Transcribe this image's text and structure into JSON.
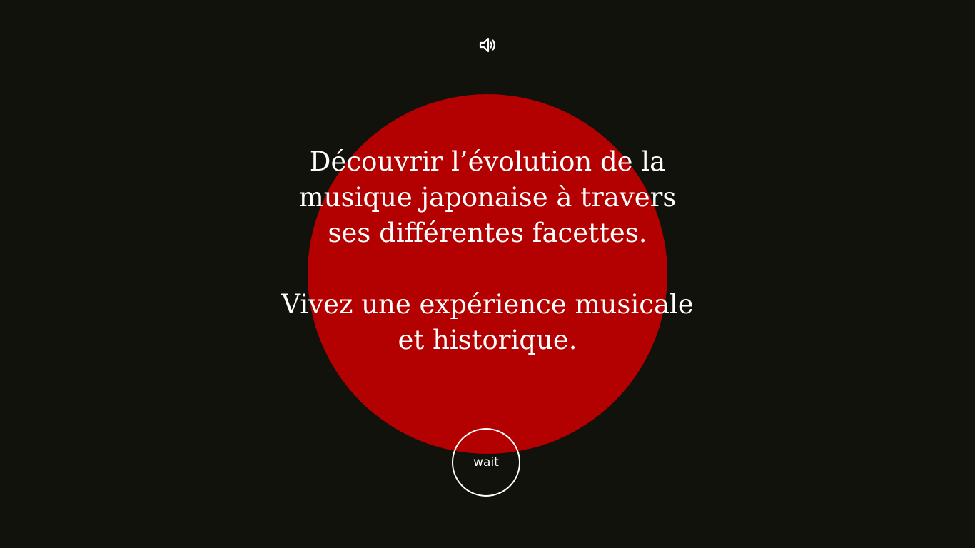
{
  "header": {
    "sound_icon": "speaker-volume-icon"
  },
  "intro": {
    "line1": "Découvrir l’évolution de la",
    "line2": "musique japonaise à travers",
    "line3": "ses différentes facettes.",
    "line4": "Vivez une expérience musicale",
    "line5": "et historique."
  },
  "action": {
    "wait_label": "wait"
  },
  "colors": {
    "background": "#11120c",
    "sun": "#b30000",
    "text": "#ffffff"
  }
}
